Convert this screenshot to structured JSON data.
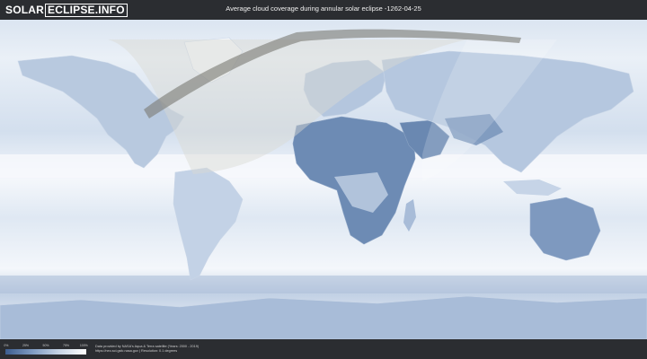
{
  "header": {
    "logo_part1": "SOLAR",
    "logo_part2": "ECLIPSE.INFO",
    "title": "Average cloud coverage during annular solar eclipse -1262-04-25"
  },
  "map": {
    "colors": {
      "ocean_clear": "#f2f6fb",
      "cloud_low": "#8ea7c9",
      "cloud_dark": "#5f7da8",
      "shadow_path": "#7c7c76",
      "visibility_zone": "#d9d9d2"
    }
  },
  "legend": {
    "ticks": [
      "0%",
      "25%",
      "50%",
      "75%",
      "100%"
    ],
    "gradient_colors": [
      "#3c5d8f",
      "#7f9bc2",
      "#c7d5e6",
      "#ffffff"
    ]
  },
  "footer": {
    "credit_line1": "Data provided by NASA's Aqua & Terra satellite (Years: 2000 - 2019)",
    "credit_line2": "https://neo.sci.gsfc.nasa.gov | Resolution: 0.1 degrees"
  }
}
